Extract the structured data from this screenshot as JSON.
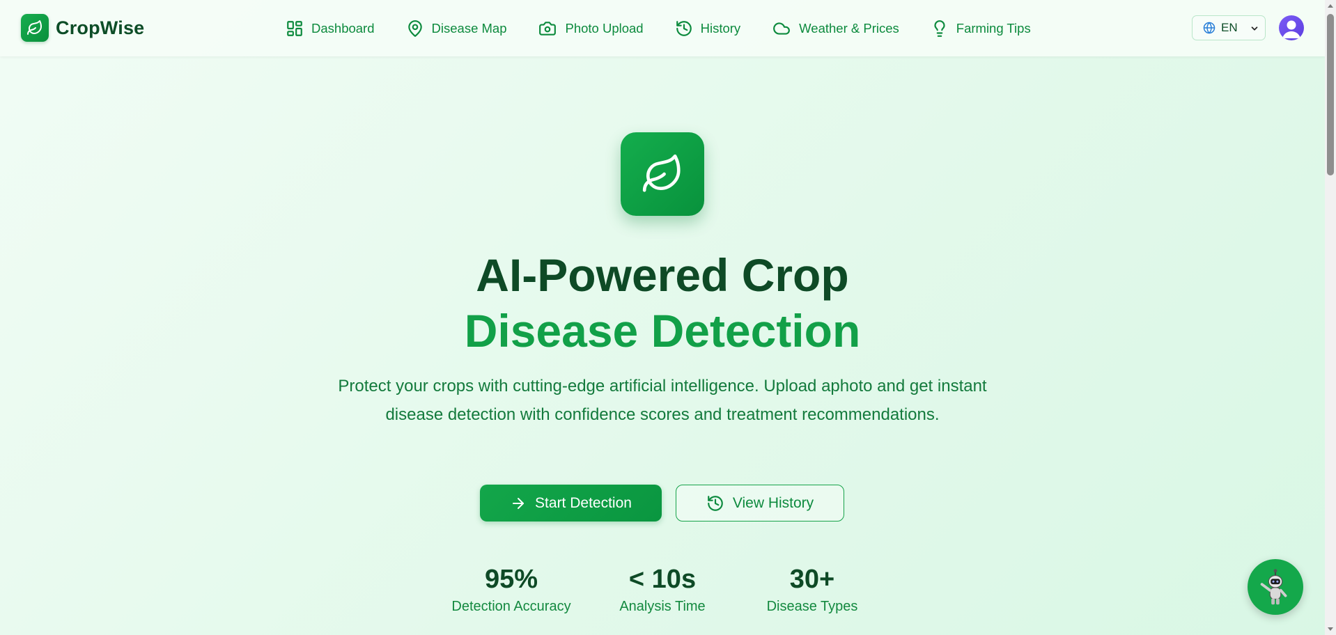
{
  "app": {
    "brand_name": "CropWise"
  },
  "nav": {
    "items": [
      {
        "label": "Dashboard",
        "icon": "dashboard-icon"
      },
      {
        "label": "Disease Map",
        "icon": "map-pin-icon"
      },
      {
        "label": "Photo Upload",
        "icon": "camera-icon"
      },
      {
        "label": "History",
        "icon": "history-icon"
      },
      {
        "label": "Weather & Prices",
        "icon": "cloud-icon"
      },
      {
        "label": "Farming Tips",
        "icon": "lightbulb-icon"
      }
    ],
    "language": {
      "selected": "EN",
      "icon": "globe-icon"
    }
  },
  "hero": {
    "title_line1": "AI-Powered Crop",
    "title_line2": "Disease Detection",
    "subtitle": "Protect your crops with cutting-edge artificial intelligence. Upload aphoto and get instant disease detection with confidence scores and treatment recommendations.",
    "primary_button": "Start Detection",
    "secondary_button": "View History"
  },
  "stats": [
    {
      "value": "95%",
      "label": "Detection Accuracy"
    },
    {
      "value": "< 10s",
      "label": "Analysis Time"
    },
    {
      "value": "30+",
      "label": "Disease Types"
    }
  ],
  "colors": {
    "brand_green": "#12a048",
    "dark_green": "#0e4a26",
    "avatar_purple": "#6d4cf0"
  }
}
